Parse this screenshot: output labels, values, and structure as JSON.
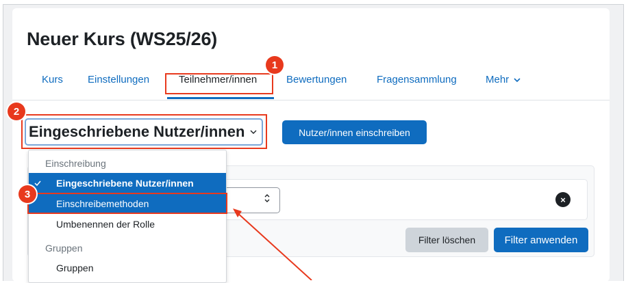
{
  "page": {
    "title": "Neuer Kurs (WS25/26)"
  },
  "tabs": [
    {
      "label": "Kurs"
    },
    {
      "label": "Einstellungen"
    },
    {
      "label": "Teilnehmer/innen"
    },
    {
      "label": "Bewertungen"
    },
    {
      "label": "Fragensammlung"
    },
    {
      "label": "Mehr"
    }
  ],
  "selector": {
    "label": "Eingeschriebene Nutzer/innen"
  },
  "buttons": {
    "enrol": "Nutzer/innen einschreiben",
    "clear_filters": "Filter löschen",
    "apply_filters": "Filter anwenden"
  },
  "filter": {
    "close_symbol": "×"
  },
  "menu": {
    "group1_header": "Einschreibung",
    "items1": [
      {
        "label": "Eingeschriebene Nutzer/innen",
        "selected": true
      },
      {
        "label": "Einschreibemethoden",
        "focused": true
      },
      {
        "label": "Umbenennen der Rolle"
      }
    ],
    "group2_header": "Gruppen",
    "items2": [
      {
        "label": "Gruppen"
      }
    ]
  },
  "annotations": [
    "1",
    "2",
    "3"
  ],
  "colors": {
    "accent": "#0f6cbf",
    "annotation": "#e8391d"
  }
}
